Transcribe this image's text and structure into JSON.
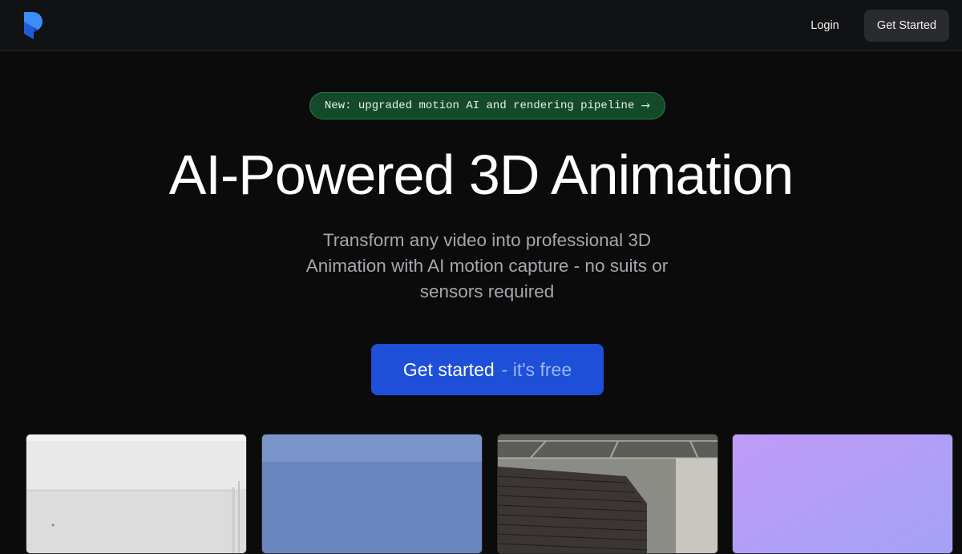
{
  "nav": {
    "login_label": "Login",
    "cta_label": "Get Started",
    "logo_color": "#1e6ef2"
  },
  "badge": {
    "text": "New: upgraded motion AI and rendering pipeline",
    "arrow": "→",
    "bg_color": "#134a2a",
    "border_color": "#2a7d4a"
  },
  "hero": {
    "title": "AI-Powered 3D Animation",
    "subtitle": "Transform any video into professional 3D Animation with AI motion capture - no suits or sensors required"
  },
  "cta": {
    "primary": "Get started",
    "secondary": "- it's free",
    "color": "#1d4fd8"
  },
  "gallery": {
    "cards": [
      {
        "subject": "white room wall"
      },
      {
        "subject": "blue sky"
      },
      {
        "subject": "brick chimney under ceiling"
      },
      {
        "subject": "purple gradient"
      }
    ]
  }
}
